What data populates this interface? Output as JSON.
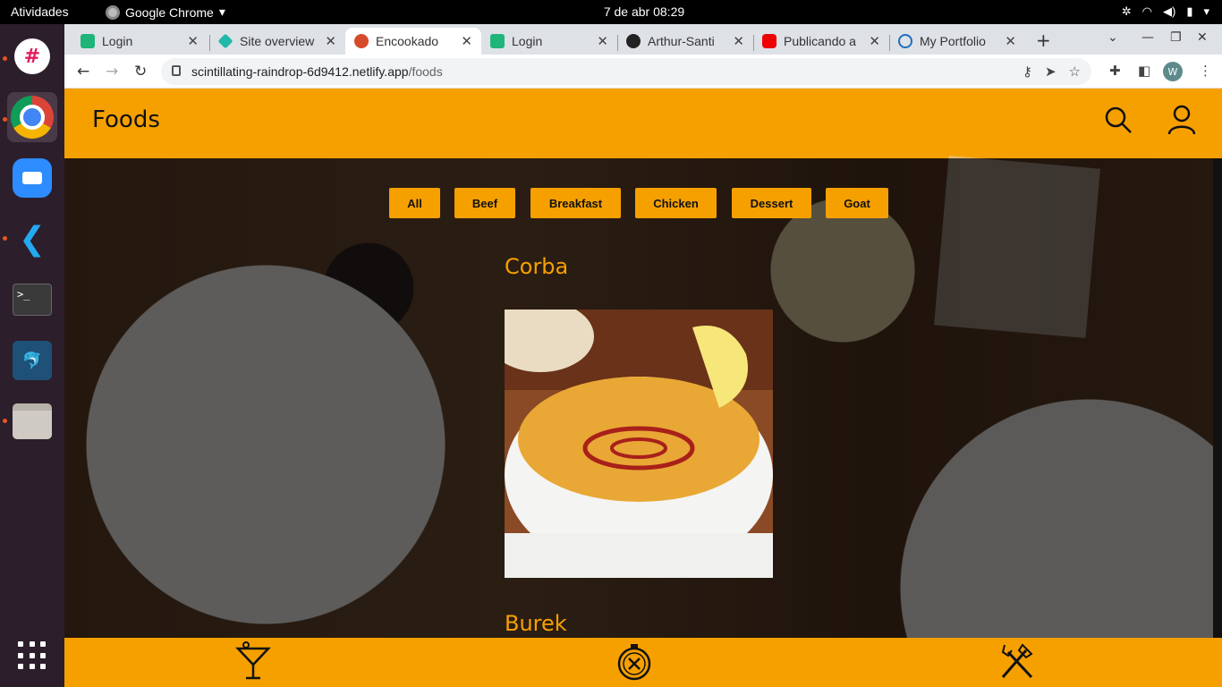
{
  "os": {
    "activities": "Atividades",
    "app_menu": "Google Chrome",
    "clock": "7 de abr  08:29"
  },
  "browser": {
    "tabs": [
      {
        "label": "Login",
        "active": false
      },
      {
        "label": "Site overview",
        "active": false
      },
      {
        "label": "Encookado",
        "active": true
      },
      {
        "label": "Login",
        "active": false
      },
      {
        "label": "Arthur-Santi",
        "active": false
      },
      {
        "label": "Publicando a",
        "active": false
      },
      {
        "label": "My Portfolio",
        "active": false
      }
    ],
    "url_host": "scintillating-raindrop-6d9412.netlify.app",
    "url_path": "/foods",
    "profile_initial": "W"
  },
  "app": {
    "header_title": "Foods",
    "filters": [
      "All",
      "Beef",
      "Breakfast",
      "Chicken",
      "Dessert",
      "Goat"
    ],
    "foods": [
      {
        "name": "Corba"
      },
      {
        "name": "Burek"
      }
    ],
    "bottom_nav": [
      "drinks-icon",
      "explore-icon",
      "foods-icon"
    ],
    "accent_color": "#f6a000"
  }
}
